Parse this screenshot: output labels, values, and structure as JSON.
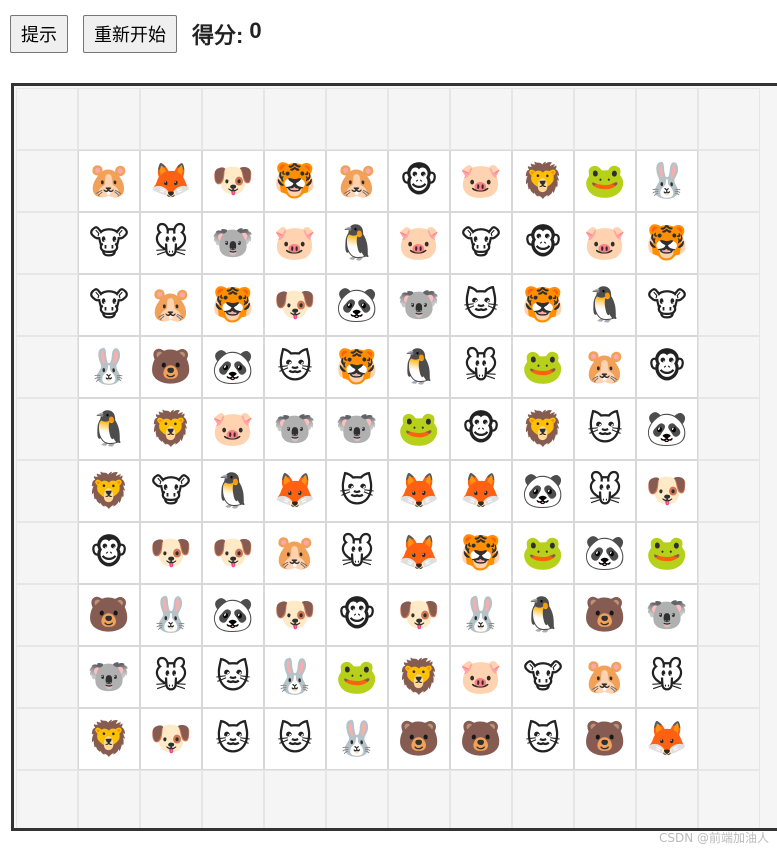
{
  "toolbar": {
    "hint_label": "提示",
    "restart_label": "重新开始",
    "score_label": "得分:",
    "score_value": "0"
  },
  "board": {
    "rows": [
      [
        "",
        "",
        "",
        "",
        "",
        "",
        "",
        "",
        "",
        "",
        "",
        ""
      ],
      [
        "",
        "🐹",
        "🦊",
        "🐶",
        "🐯",
        "🐹",
        "🐵",
        "🐷",
        "🦁",
        "🐸",
        "🐰",
        ""
      ],
      [
        "",
        "🐮",
        "🐭",
        "🐨",
        "🐷",
        "🐧",
        "🐷",
        "🐮",
        "🐵",
        "🐷",
        "🐯",
        ""
      ],
      [
        "",
        "🐮",
        "🐹",
        "🐯",
        "🐶",
        "🐼",
        "🐨",
        "🐱",
        "🐯",
        "🐧",
        "🐮",
        ""
      ],
      [
        "",
        "🐰",
        "🐻",
        "🐼",
        "🐱",
        "🐯",
        "🐧",
        "🐭",
        "🐸",
        "🐹",
        "🐵",
        ""
      ],
      [
        "",
        "🐧",
        "🦁",
        "🐷",
        "🐨",
        "🐨",
        "🐸",
        "🐵",
        "🦁",
        "🐱",
        "🐼",
        ""
      ],
      [
        "",
        "🦁",
        "🐮",
        "🐧",
        "🦊",
        "🐱",
        "🦊",
        "🦊",
        "🐼",
        "🐭",
        "🐶",
        ""
      ],
      [
        "",
        "🐵",
        "🐶",
        "🐶",
        "🐹",
        "🐭",
        "🦊",
        "🐯",
        "🐸",
        "🐼",
        "🐸",
        ""
      ],
      [
        "",
        "🐻",
        "🐰",
        "🐼",
        "🐶",
        "🐵",
        "🐶",
        "🐰",
        "🐧",
        "🐻",
        "🐨",
        ""
      ],
      [
        "",
        "🐨",
        "🐭",
        "🐱",
        "🐰",
        "🐸",
        "🦁",
        "🐷",
        "🐮",
        "🐹",
        "🐭",
        ""
      ],
      [
        "",
        "🦁",
        "🐶",
        "🐱",
        "🐱",
        "🐰",
        "🐻",
        "🐻",
        "🐱",
        "🐻",
        "🦊",
        ""
      ],
      [
        "",
        "",
        "",
        "",
        "",
        "",
        "",
        "",
        "",
        "",
        "",
        ""
      ]
    ]
  },
  "watermark": "CSDN @前端加油人"
}
